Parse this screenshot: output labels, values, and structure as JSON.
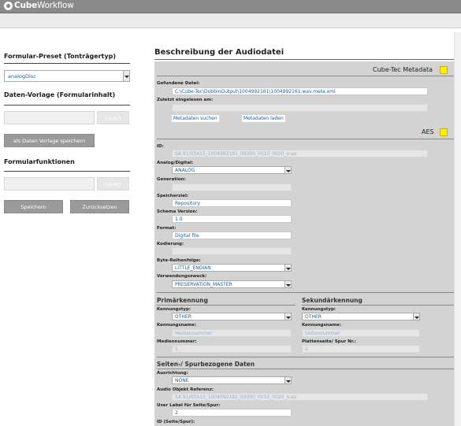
{
  "app": {
    "logo_bold": "Cube",
    "logo_rest": "Workflow"
  },
  "left": {
    "preset_title": "Formular-Preset (Tonträgertyp)",
    "preset_value": "analogDisc",
    "template_title": "Daten-Vorlage (Formularinhalt)",
    "template_input": "",
    "load_label": "Laden",
    "save_template_label": "als Daten Vorlage speichern",
    "functions_title": "Formularfunktionen",
    "functions_input": "",
    "load2_label": "Laden",
    "save_label": "Speichern",
    "reset_label": "Zurücksetzen"
  },
  "right": {
    "title": "Beschreibung der Audiodatei",
    "cubetec_section": "Cube-Tec Metadata",
    "found_file_label": "Gefundene Datei:",
    "found_file_value": "C:\\Cube-Tec\\DobbinOutput\\1004992161\\1004992161.wav.meta.xml",
    "last_read_label": "Zuletzt eingelesen am:",
    "last_read_value": "",
    "search_metadata": "Metadaten suchen",
    "load_metadata": "Metadaten laden",
    "aes_section": "AES",
    "id_label": "ID:",
    "id_value": "SA 91/03413_1004992181_00000_0010_0020_o-as",
    "analog_label": "Analog/Digital:",
    "analog_value": "ANALOG",
    "generation_label": "Generation:",
    "generation_value": "",
    "target_label": "Speicherziel:",
    "target_value": "Repository",
    "schema_label": "Schema Version:",
    "schema_value": "1.0",
    "format_label": "Format:",
    "format_value": "Digital file",
    "encoding_label": "Kodierung:",
    "encoding_value": "",
    "byteorder_label": "Byte-Reihenfolge:",
    "byteorder_value": "LITTLE_ENDIAN",
    "purpose_label": "Verwendungszweck:",
    "purpose_value": "PRESERVATION_MASTER",
    "primary_title": "Primärkennung",
    "secondary_title": "Sekundärkennung",
    "p_type_label": "Kennungstyp:",
    "p_type_value": "OTHER",
    "s_type_label": "Kennungstyp:",
    "s_type_value": "OTHER",
    "p_name_label": "Kennungsname:",
    "p_name_value": "Mediennummer",
    "s_name_label": "Kennungsname:",
    "s_name_value": "Seitennummer",
    "p_num_label": "Mediennummer:",
    "p_num_value": "1",
    "s_num_label": "Plattenseite/ Spur Nr.:",
    "s_num_value": "2",
    "side_title": "Seiten-/ Spurbezogene Daten",
    "orientation_label": "Ausrichtung:",
    "orientation_value": "NONE",
    "audio_ref_label": "Audio Objekt Referenz:",
    "audio_ref_value": "SA 91/03413_1004992181_00000_0010_0020_o-as",
    "user_label_label": "User Label für Seite/Spur:",
    "user_label_value": "2",
    "side_id_label": "ID (Seite/Spur):"
  }
}
